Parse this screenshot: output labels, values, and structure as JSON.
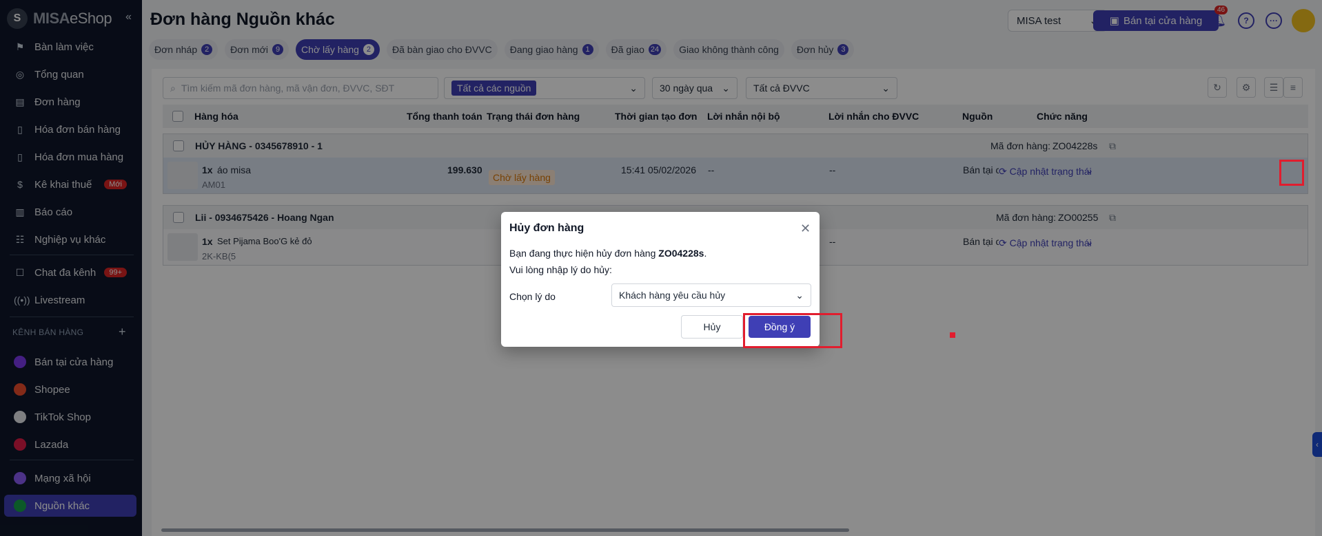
{
  "sidebar": {
    "logo": "MISA eShop",
    "logo_brand": "MISA",
    "logo_product": "eShop",
    "collapse": "«",
    "items": [
      {
        "label": "Bàn làm việc",
        "icon": "desk-icon"
      },
      {
        "label": "Tổng quan",
        "icon": "dashboard-icon"
      },
      {
        "label": "Đơn hàng",
        "icon": "order-icon"
      },
      {
        "label": "Hóa đơn bán hàng",
        "icon": "invoice-icon"
      },
      {
        "label": "Hóa đơn mua hàng",
        "icon": "purchase-icon"
      },
      {
        "label": "Kê khai thuế",
        "icon": "tax-icon",
        "badge": "Mới"
      },
      {
        "label": "Báo cáo",
        "icon": "chart-icon"
      },
      {
        "label": "Nghiệp vụ khác",
        "icon": "more-icon"
      },
      {
        "label": "Chat đa kênh",
        "icon": "chat-icon",
        "badge": "99+"
      },
      {
        "label": "Livestream",
        "icon": "livestream-icon"
      }
    ],
    "section_label": "KÊNH BÁN HÀNG",
    "channels": [
      {
        "label": "Bán tại cửa hàng",
        "color": "#7c3aed"
      },
      {
        "label": "Shopee",
        "color": "#ee4d2d"
      },
      {
        "label": "TikTok Shop",
        "color": "#111827"
      },
      {
        "label": "Lazada",
        "color": "#e11d48"
      },
      {
        "label": "Mạng xã hội",
        "color": "#8b5cf6"
      },
      {
        "label": "Nguồn khác",
        "color": "#16a34a",
        "active": true
      }
    ]
  },
  "header": {
    "title": "Đơn hàng Nguồn khác",
    "shop": "MISA test",
    "pos_button": "Bán tại cửa hàng",
    "notifications": "46"
  },
  "tabs": [
    {
      "label": "Đơn nháp",
      "count": "2"
    },
    {
      "label": "Đơn mới",
      "count": "9"
    },
    {
      "label": "Chờ lấy hàng",
      "count": "2",
      "active": true
    },
    {
      "label": "Đã bàn giao cho ĐVVC",
      "count": ""
    },
    {
      "label": "Đang giao hàng",
      "count": "1"
    },
    {
      "label": "Đã giao",
      "count": "24"
    },
    {
      "label": "Giao không thành công",
      "count": ""
    },
    {
      "label": "Đơn hủy",
      "count": "3"
    }
  ],
  "filters": {
    "search_placeholder": "Tìm kiếm mã đơn hàng, mã vận đơn, ĐVVC, SĐT",
    "source": "Tất cả các nguồn",
    "period": "30 ngày qua",
    "carrier": "Tất cả ĐVVC"
  },
  "table": {
    "columns": [
      "Hàng hóa",
      "Tổng thanh toán",
      "Trạng thái đơn hàng",
      "Thời gian tạo đơn",
      "Lời nhắn nội bộ",
      "Lời nhắn cho ĐVVC",
      "Nguồn",
      "Chức năng"
    ],
    "groups": [
      {
        "header": "HỦY HÀNG - 0345678910 - 1",
        "order_label": "Mã đơn hàng:",
        "order_code": "ZO04228s",
        "qty": "1x",
        "item": "áo misa",
        "sku": "AM01",
        "total": "199.630",
        "status": "Chờ lấy hàng",
        "created": "15:41 05/02/2026",
        "internal_note": "--",
        "carrier_note": "--",
        "source": "Bán tại c",
        "action": "Cập nhật trạng thái"
      },
      {
        "header": "Lii - 0934675426 - Hoang Ngan",
        "order_label": "Mã đơn hàng:",
        "order_code": "ZO00255",
        "qty": "1x",
        "item": "Set Pijama Boo'G kẻ đỏ",
        "sku": "2K-KB(5",
        "internal_note": "--",
        "carrier_note": "--",
        "source": "Bán tại c",
        "action": "Cập nhật trạng thái"
      }
    ]
  },
  "dialog": {
    "title": "Hủy đơn hàng",
    "line1_prefix": "Bạn đang thực hiện hủy đơn hàng ",
    "line1_code": "ZO04228s",
    "line1_suffix": ".",
    "line2": "Vui lòng nhập lý do hủy:",
    "reason_label": "Chọn lý do",
    "reason_value": "Khách hàng yêu cầu hủy",
    "cancel": "Hủy",
    "confirm": "Đồng ý"
  }
}
